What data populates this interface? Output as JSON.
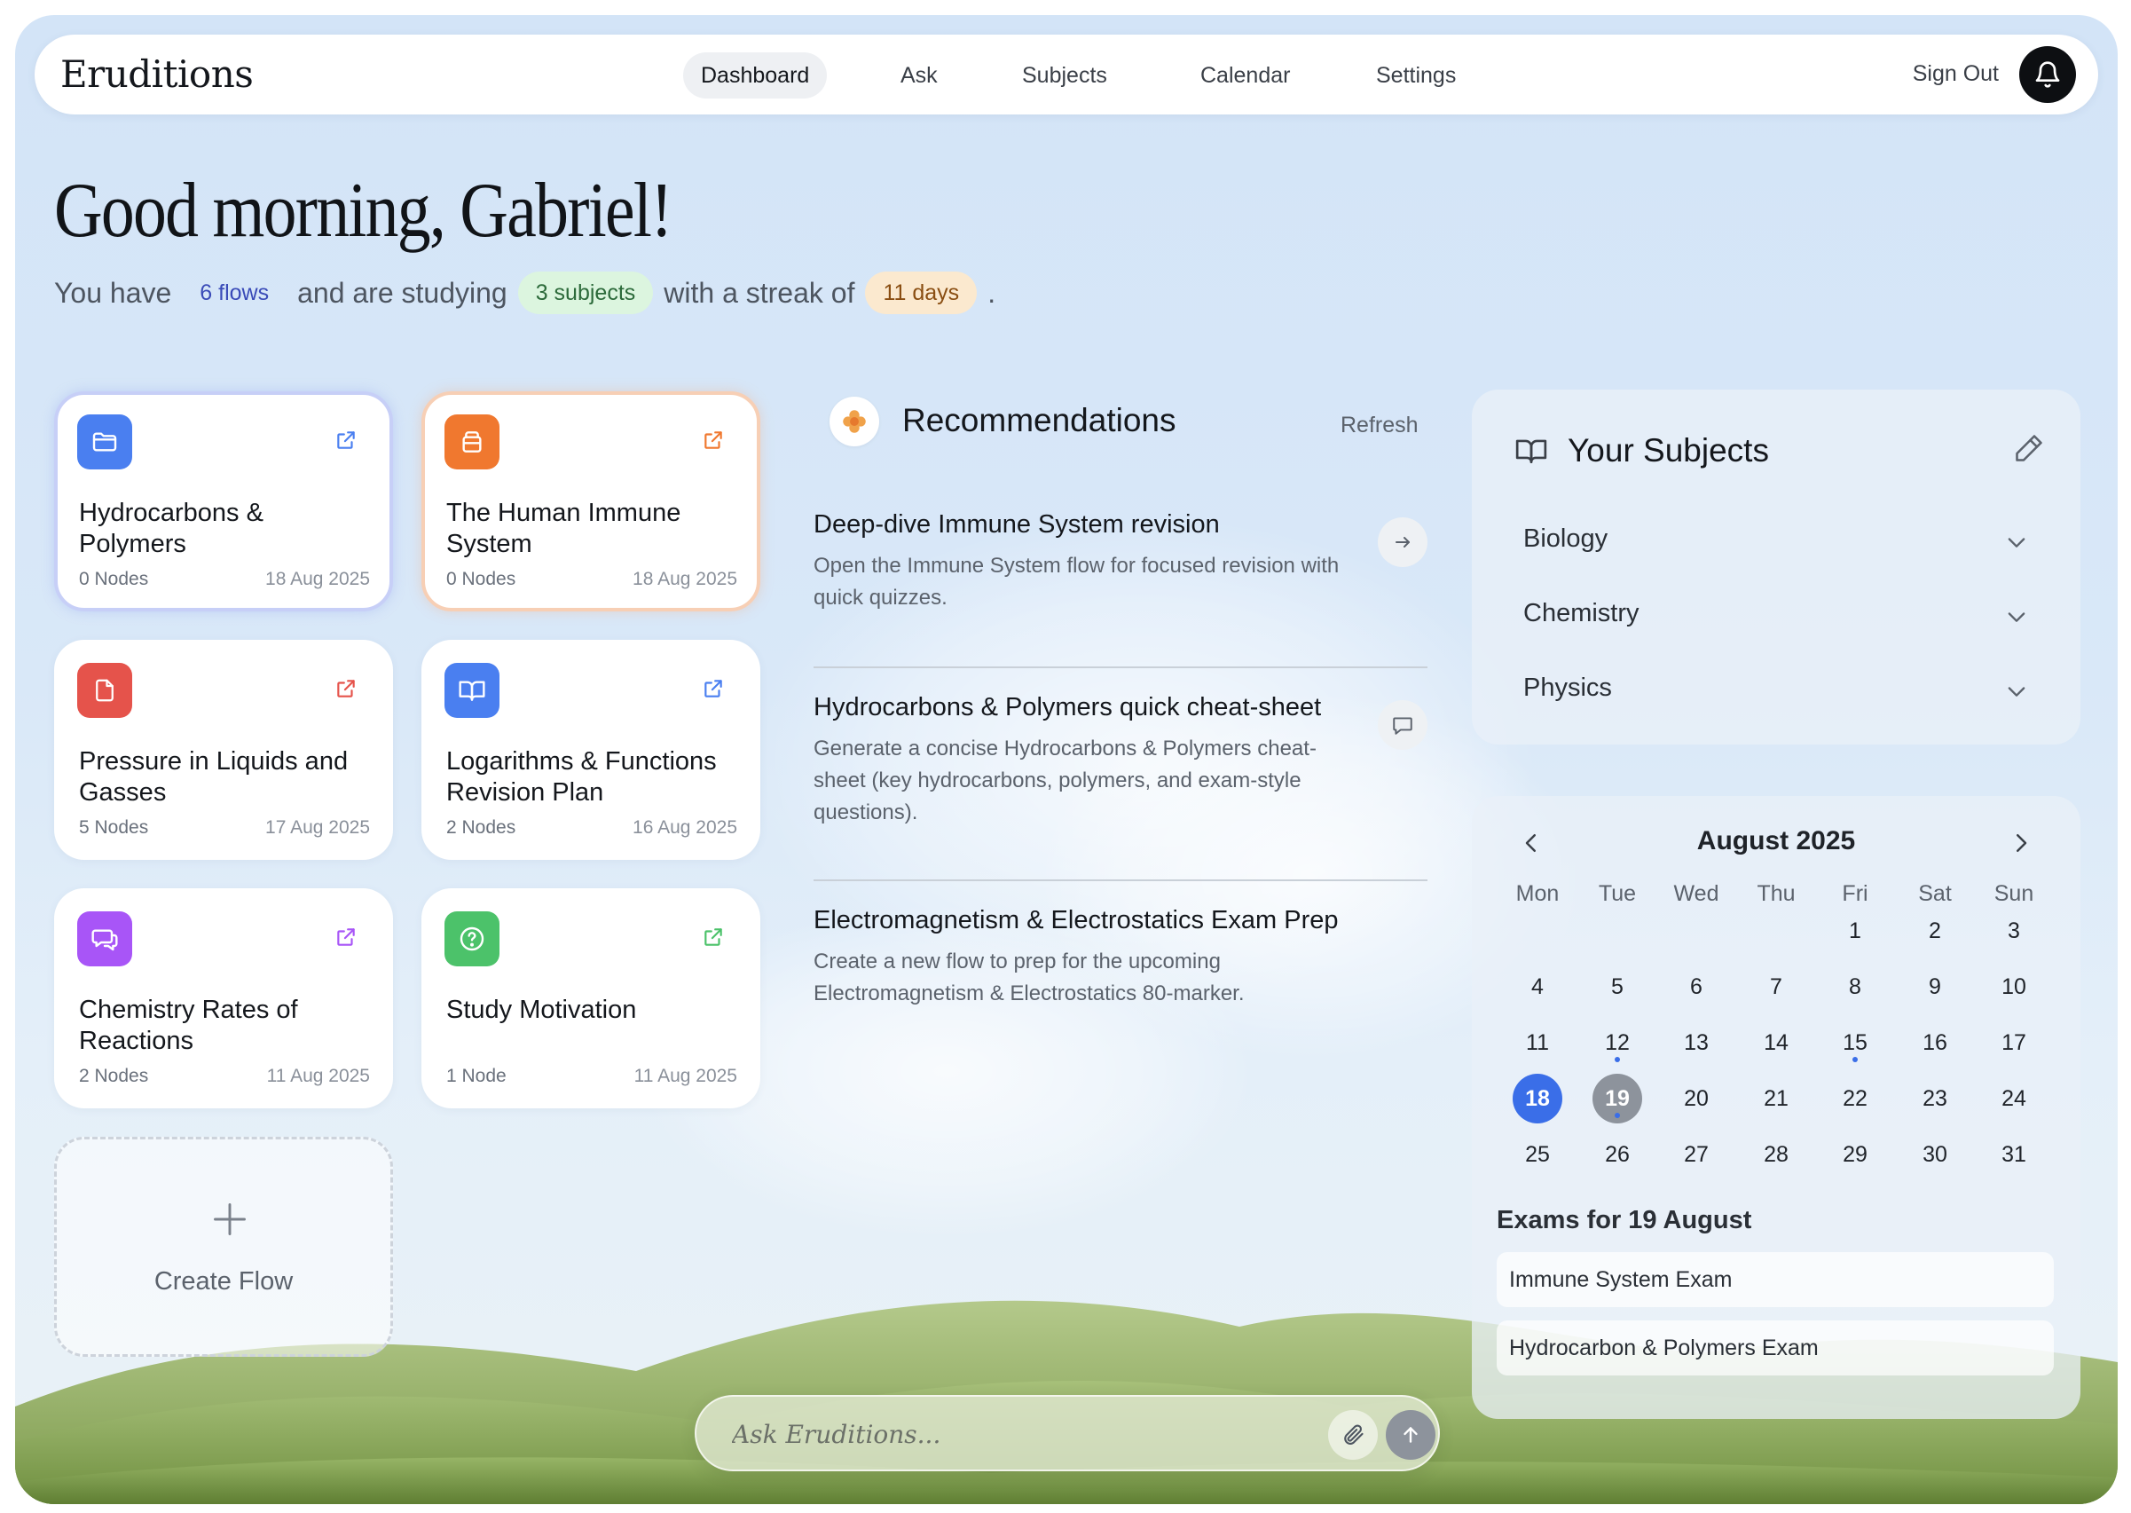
{
  "app": {
    "title": "Eruditions"
  },
  "nav": {
    "items": [
      {
        "label": "Dashboard",
        "active": true
      },
      {
        "label": "Ask",
        "active": false
      },
      {
        "label": "Subjects",
        "active": false
      },
      {
        "label": "Calendar",
        "active": false
      },
      {
        "label": "Settings",
        "active": false
      }
    ],
    "sign_out": "Sign Out",
    "bell_icon": "bell-icon"
  },
  "greeting": {
    "title": "Good morning, Gabriel!",
    "summary": {
      "part1": "You have",
      "flows": "6 flows",
      "part2": "and are studying",
      "subjects": "3 subjects",
      "part3": "with a streak of",
      "streak": "11 days",
      "end": "."
    }
  },
  "colors": {
    "blue": "#4a7ff0",
    "orange": "#f0782f",
    "red": "#e5534b",
    "purple": "#a855f7",
    "green": "#4cc26a",
    "today": "#3a6ee8"
  },
  "flows": [
    {
      "title": "Hydrocarbons & Polymers",
      "nodes": "0 Nodes",
      "date": "18 Aug 2025",
      "icon": "folder-icon",
      "color": "#4a7ff0"
    },
    {
      "title": "The Human Immune System",
      "nodes": "0 Nodes",
      "date": "18 Aug 2025",
      "icon": "archive-icon",
      "color": "#f0782f"
    },
    {
      "title": "Pressure in Liquids and Gasses",
      "nodes": "5 Nodes",
      "date": "17 Aug 2025",
      "icon": "file-icon",
      "color": "#e5534b"
    },
    {
      "title": "Logarithms & Functions Revision Plan",
      "nodes": "2 Nodes",
      "date": "16 Aug 2025",
      "icon": "book-icon",
      "color": "#4a7ff0"
    },
    {
      "title": "Chemistry Rates of Reactions",
      "nodes": "2 Nodes",
      "date": "11 Aug 2025",
      "icon": "chat-icon",
      "color": "#a855f7"
    },
    {
      "title": "Study Motivation",
      "nodes": "1 Node",
      "date": "11 Aug 2025",
      "icon": "help-circle-icon",
      "color": "#4cc26a"
    }
  ],
  "create_flow": {
    "label": "Create Flow"
  },
  "recommendations": {
    "title": "Recommendations",
    "refresh": "Refresh",
    "items": [
      {
        "title": "Deep-dive Immune System revision",
        "desc": "Open the Immune System flow for focused revision with quick quizzes.",
        "icon": "arrow-right-icon"
      },
      {
        "title": "Hydrocarbons & Polymers quick cheat-sheet",
        "desc": "Generate a concise Hydrocarbons & Polymers cheat-sheet (key hydrocarbons, polymers, and exam-style questions).",
        "icon": "chat-bubble-icon"
      },
      {
        "title": "Electromagnetism & Electrostatics Exam Prep",
        "desc": "Create a new flow to prep for the upcoming Electromagnetism & Electrostatics 80-marker.",
        "icon": ""
      }
    ]
  },
  "subjects": {
    "title": "Your Subjects",
    "items": [
      "Biology",
      "Chemistry",
      "Physics"
    ]
  },
  "calendar": {
    "month": "August 2025",
    "weekdays": [
      "Mon",
      "Tue",
      "Wed",
      "Thu",
      "Fri",
      "Sat",
      "Sun"
    ],
    "first_weekday_index": 4,
    "days_in_month": 31,
    "today": 18,
    "selected": 19,
    "dot_days": [
      12,
      15,
      19
    ],
    "exams_title": "Exams for 19 August",
    "exams": [
      "Immune System Exam",
      "Hydrocarbon & Polymers Exam"
    ]
  },
  "ask": {
    "placeholder": "Ask Eruditions..."
  }
}
